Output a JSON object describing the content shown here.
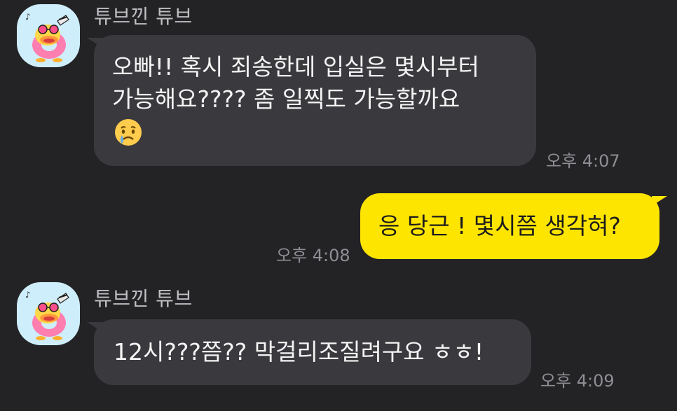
{
  "messages": [
    {
      "sender": "튜브낀 튜브",
      "lines": [
        "오빠!! 혹시 죄송한데 입실은 몇시부터",
        "가능해요???? 좀 일찍도 가능할까요"
      ],
      "emoji": "crying-face",
      "time": "오후 4:07"
    },
    {
      "text": "응 당근 ! 몇시쯤 생각혀?",
      "time": "오후 4:08"
    },
    {
      "sender": "튜브낀 튜브",
      "text": "12시???쯤?? 막걸리조질려구요 ㅎㅎ!",
      "time": "오후 4:09"
    }
  ],
  "colors": {
    "background": "#232326",
    "incoming_bubble": "#3a3a3e",
    "outgoing_bubble": "#fee500",
    "avatar_bg": "#cfeefb"
  }
}
